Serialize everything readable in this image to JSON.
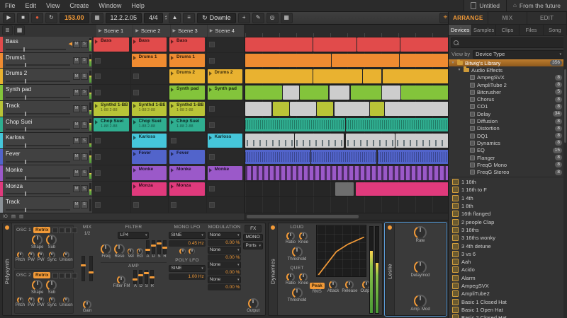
{
  "window": {
    "tabs": [
      {
        "label": "Untitled",
        "icon": "document-icon"
      },
      {
        "label": "From the future",
        "icon": "home-icon"
      }
    ]
  },
  "menu": {
    "items": [
      "File",
      "Edit",
      "View",
      "Create",
      "Window",
      "Help"
    ]
  },
  "transport": {
    "tempo": "153.00",
    "position": "12.2.2.05",
    "signature": "4/4",
    "download_label": "Downle"
  },
  "view_switch": {
    "items": [
      {
        "label": "ARRANGE",
        "active": true
      },
      {
        "label": "MIX",
        "active": false
      },
      {
        "label": "EDIT",
        "active": false
      }
    ]
  },
  "accent": "#f29a38",
  "session": {
    "io_label": "IO",
    "scenes": [
      "Scene 1",
      "Scene 2",
      "Scene 3",
      "Scene 4"
    ],
    "tracks": [
      {
        "name": "Bass",
        "color": "#e14b4b",
        "armed": true,
        "meter": 0.85,
        "clips": [
          {
            "label": "Bass"
          },
          {
            "label": "Bass"
          },
          {
            "label": "Bass"
          },
          null
        ]
      },
      {
        "name": "Drums1",
        "color": "#ef8b31",
        "meter": 0.6,
        "clips": [
          null,
          {
            "label": "Drums 1"
          },
          {
            "label": "Drums 1"
          },
          null
        ]
      },
      {
        "name": "Drums 2",
        "color": "#e9b230",
        "meter": 0.55,
        "clips": [
          null,
          null,
          {
            "label": "Drums 2"
          },
          {
            "label": "Drums 2"
          }
        ]
      },
      {
        "name": "Synth pad",
        "color": "#83c43b",
        "meter": 0.5,
        "clips": [
          null,
          null,
          {
            "label": "Synth pad"
          },
          {
            "label": "Synth pad"
          }
        ]
      },
      {
        "name": "Track",
        "color": "#b9c437",
        "meter": 0.4,
        "clips": [
          {
            "label": "Synthd 1-BB",
            "sub": "1-88 2-88"
          },
          {
            "label": "Synthd 1-BB",
            "sub": "1-88 2-88"
          },
          {
            "label": "Synthd 1-BB",
            "sub": "1-88 2-88"
          },
          null
        ]
      },
      {
        "name": "Chop Suei",
        "color": "#2fae90",
        "meter": 0.65,
        "clips": [
          {
            "label": "Chop Suei",
            "sub": "1-88 2-88"
          },
          {
            "label": "Chop Suei",
            "sub": "1-88 2-88"
          },
          {
            "label": "Chop Suei",
            "sub": "1-88 2-88"
          },
          null
        ]
      },
      {
        "name": "Karloss",
        "color": "#45c6da",
        "meter": 0.3,
        "clips": [
          null,
          {
            "label": "Karloss"
          },
          null,
          {
            "label": "Karloss"
          }
        ]
      },
      {
        "name": "Fever",
        "color": "#5264cb",
        "meter": 0.6,
        "clips": [
          null,
          {
            "label": "Fever"
          },
          {
            "label": "Fever"
          },
          null
        ]
      },
      {
        "name": "Monke",
        "color": "#9b59c9",
        "meter": 0.5,
        "clips": [
          null,
          {
            "label": "Monke"
          },
          {
            "label": "Monke"
          },
          {
            "label": "Monke"
          }
        ]
      },
      {
        "name": "Monza",
        "color": "#e03a7c",
        "meter": 0.45,
        "clips": [
          null,
          {
            "label": "Monza"
          },
          {
            "label": "Monza"
          },
          null
        ]
      },
      {
        "name": "Track",
        "color": "#8a9096",
        "meter": 0,
        "clips": [
          null,
          null,
          null,
          null
        ]
      }
    ]
  },
  "arrangement": {
    "rows": [
      {
        "color": "#e14b4b",
        "texture": "flat",
        "segments": [
          [
            0,
            33
          ],
          [
            33.4,
            21
          ],
          [
            54.8,
            21
          ],
          [
            76.2,
            23.8
          ]
        ]
      },
      {
        "color": "#ef8b31",
        "texture": "flat",
        "segments": [
          [
            0,
            42
          ],
          [
            42.4,
            33
          ],
          [
            75.8,
            24.2
          ]
        ]
      },
      {
        "color": "#e9b230",
        "texture": "flat",
        "segments": [
          [
            0,
            33
          ],
          [
            33.4,
            24
          ],
          [
            57.8,
            9
          ],
          [
            67.2,
            32.8
          ]
        ]
      },
      {
        "color": "#83c43b",
        "texture": "flat",
        "segments": [
          [
            0,
            18
          ],
          [
            18.4,
            8,
            "pale"
          ],
          [
            26.8,
            14
          ],
          [
            41.2,
            10,
            "pale"
          ],
          [
            51.6,
            15
          ],
          [
            67,
            9,
            "pale"
          ],
          [
            76.4,
            23.6
          ]
        ]
      },
      {
        "color": "#b9c437",
        "texture": "flat",
        "segments": [
          [
            0,
            13,
            "pale"
          ],
          [
            13.4,
            8
          ],
          [
            21.8,
            13,
            "pale"
          ],
          [
            35.2,
            8
          ],
          [
            43.6,
            17,
            "pale"
          ],
          [
            61,
            7
          ],
          [
            68.4,
            31.6,
            "pale"
          ]
        ]
      },
      {
        "color": "#2fae90",
        "texture": "wave",
        "segments": [
          [
            0,
            49
          ],
          [
            49.4,
            50.6
          ]
        ]
      },
      {
        "color": "#45c6da",
        "texture": "hits",
        "segments": [
          [
            0,
            24,
            "pale"
          ],
          [
            24.4,
            24,
            "pale"
          ],
          [
            49.2,
            24,
            "pale"
          ],
          [
            73.6,
            26.4,
            "pale"
          ]
        ]
      },
      {
        "color": "#5264cb",
        "texture": "wave",
        "segments": [
          [
            0,
            32
          ],
          [
            32.4,
            32
          ],
          [
            64.8,
            35.2
          ]
        ]
      },
      {
        "color": "#9b59c9",
        "texture": "cells",
        "segments": [
          [
            0,
            100
          ]
        ]
      },
      {
        "color": "#e03a7c",
        "texture": "flat",
        "segments": [
          [
            44,
            9,
            "dim"
          ],
          [
            54,
            46
          ]
        ]
      },
      {
        "color": "#8a9096",
        "texture": "flat",
        "segments": []
      }
    ]
  },
  "browser": {
    "tabs": [
      {
        "label": "Devices",
        "active": true
      },
      {
        "label": "Samples",
        "active": false
      },
      {
        "label": "Clips",
        "active": false
      },
      {
        "label": "Files",
        "active": false
      },
      {
        "label": "Song",
        "active": false
      }
    ],
    "view_by_label": "View by",
    "view_by_value": "Device Type",
    "tree": [
      {
        "label": "Bitwig's Library",
        "badge": "356",
        "level": 0,
        "icon": "folder",
        "selected": true
      },
      {
        "label": "Audio Effects",
        "badge": "",
        "level": 1,
        "icon": "folder",
        "selected": false
      },
      {
        "label": "AmpegSVX",
        "badge": "8",
        "level": 2,
        "icon": "device",
        "selected": false
      },
      {
        "label": "AmpliTube 2",
        "badge": "8",
        "level": 2,
        "icon": "device",
        "selected": false
      },
      {
        "label": "Bitcrusher",
        "badge": "5",
        "level": 2,
        "icon": "device",
        "selected": false
      },
      {
        "label": "Chorus",
        "badge": "8",
        "level": 2,
        "icon": "device",
        "selected": false
      },
      {
        "label": "CO1",
        "badge": "8",
        "level": 2,
        "icon": "device",
        "selected": false
      },
      {
        "label": "Delay",
        "badge": "34",
        "level": 2,
        "icon": "device",
        "selected": false
      },
      {
        "label": "Diffusion",
        "badge": "8",
        "level": 2,
        "icon": "device",
        "selected": false
      },
      {
        "label": "Distortion",
        "badge": "8",
        "level": 2,
        "icon": "device",
        "selected": false
      },
      {
        "label": "DQ1",
        "badge": "8",
        "level": 2,
        "icon": "device",
        "selected": false
      },
      {
        "label": "Dynamics",
        "badge": "8",
        "level": 2,
        "icon": "device",
        "selected": false
      },
      {
        "label": "EQ",
        "badge": "15",
        "level": 2,
        "icon": "device",
        "selected": false
      },
      {
        "label": "Flanger",
        "badge": "8",
        "level": 2,
        "icon": "device",
        "selected": false
      },
      {
        "label": "FreqG Mono",
        "badge": "8",
        "level": 2,
        "icon": "device",
        "selected": false
      },
      {
        "label": "FreqG Stereo",
        "badge": "8",
        "level": 2,
        "icon": "device",
        "selected": false
      }
    ],
    "files": [
      "1 16th",
      "1 16th to F",
      "1 4th",
      "1 8th",
      "16th flanged",
      "2 people Clap",
      "3 16ths",
      "3 16ths wonky",
      "3 4th detune",
      "3 vs 6",
      "Aah",
      "Acido",
      "Alarm",
      "AmpegSVX",
      "AmpliTube2",
      "Basic 1 Closed Hat",
      "Basic 1 Open Hat",
      "Basic 2 Closed Hat"
    ]
  },
  "polysynth": {
    "title": "Polysynth",
    "osc1": {
      "label": "OSC 1",
      "preset": "Retrix",
      "knobs": [
        "Shape",
        "Sub"
      ],
      "mini": [
        "Pitch",
        "PW",
        "PW",
        "Sync",
        "Unison"
      ]
    },
    "osc2": {
      "label": "OSC 2",
      "preset": "Retrix",
      "knobs": [
        "Shape",
        "Sub"
      ],
      "mini": [
        "Pitch",
        "PW",
        "PW",
        "Sync",
        "Unison"
      ]
    },
    "mix": {
      "label": "MIX",
      "ratio_label": "1/2",
      "knobs": [
        "Gain"
      ]
    },
    "filter": {
      "label": "FILTER",
      "mode": "LP4",
      "knobs": [
        "Freq",
        "Reso"
      ],
      "mini": [
        "Vel",
        "EG"
      ],
      "adsr": [
        "A",
        "D",
        "S",
        "R"
      ]
    },
    "amp": {
      "label": "AMP",
      "knobs": [
        "Filter FM"
      ],
      "adsr": [
        "A",
        "D",
        "S",
        "R"
      ]
    },
    "mono_lfo": {
      "label": "MONO LFO",
      "wave": "SINE",
      "rate": "0.45 Hz",
      "mini": [
        "",
        ""
      ]
    },
    "poly_lfo": {
      "label": "POLY LFO",
      "wave": "SINE",
      "rate": "1.00 Hz"
    },
    "modulation": {
      "label": "MODULATION",
      "rows": [
        {
          "source": "None",
          "amount": "0.00 %"
        },
        {
          "source": "None",
          "amount": "0.00 %"
        },
        {
          "source": "None",
          "amount": "0.00 %"
        },
        {
          "source": "None",
          "amount": "0.00 %"
        }
      ]
    },
    "fx_label": "FX",
    "mono_label": "MONO",
    "ports_label": "Ports",
    "out_knobs": [
      "Output"
    ]
  },
  "dynamics": {
    "title": "Dynamics",
    "loud": {
      "label": "LOUD",
      "knobs": [
        "Ratio",
        "Knee"
      ],
      "threshold": [
        "Threshold"
      ]
    },
    "quet": {
      "label": "QUET",
      "knobs": [
        "Ratio",
        "Knee"
      ],
      "threshold": [
        "Threshold"
      ]
    },
    "peak_label": "Peak",
    "rms_label": "RMS",
    "bottom_knobs": [
      "Attack",
      "Release",
      "Output"
    ]
  },
  "leslie": {
    "title": "Leslie",
    "knobs": [
      "Rate",
      "Delaymod",
      "Amp. Mod"
    ]
  }
}
